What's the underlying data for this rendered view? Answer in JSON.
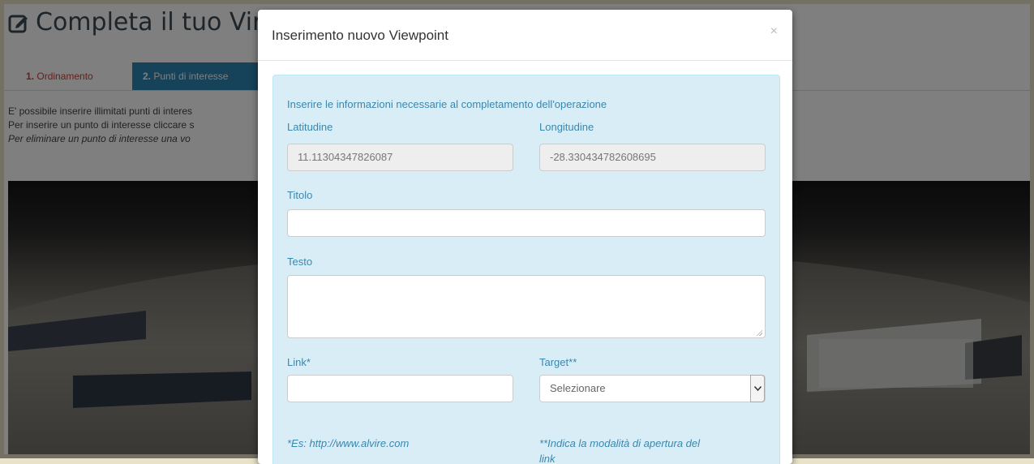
{
  "page": {
    "title": "Completa il tuo Vir",
    "tabs": [
      {
        "number": "1.",
        "label": "Ordinamento"
      },
      {
        "number": "2.",
        "label": "Punti di interesse"
      }
    ],
    "intro": [
      "E' possibile inserire illimitati punti di interes",
      "Per inserire un punto di interesse cliccare s",
      "Per eliminare un punto di interesse una vo"
    ],
    "title_icon": "edit-icon"
  },
  "modal": {
    "title": "Inserimento nuovo Viewpoint",
    "close": "×",
    "info": "Inserire le informazioni necessarie al completamento dell'operazione",
    "latitude": {
      "label": "Latitudine",
      "value": "11.11304347826087"
    },
    "longitude": {
      "label": "Longitudine",
      "value": "-28.330434782608695"
    },
    "title_field": {
      "label": "Titolo",
      "value": ""
    },
    "text_field": {
      "label": "Testo",
      "value": ""
    },
    "link": {
      "label": "Link*",
      "value": ""
    },
    "target": {
      "label": "Target**",
      "selected": "Selezionare"
    },
    "note_link": "*Es: http://www.alvire.com",
    "note_target_1": "**Indica la modalità di apertura del",
    "note_target_2": "link"
  },
  "colors": {
    "accent_tab": "#2d85b4",
    "tab_inactive": "#c9413a",
    "panel_bg": "#d9edf7",
    "label": "#3a87ad"
  }
}
